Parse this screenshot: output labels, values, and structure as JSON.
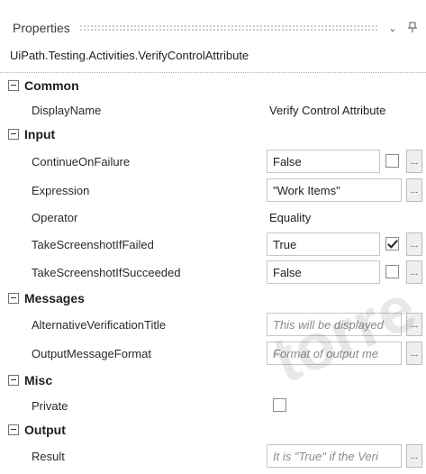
{
  "panel": {
    "title": "Properties",
    "dropdown_glyph": "⌄",
    "pin_glyph": "ꟷ",
    "type_name": "UiPath.Testing.Activities.VerifyControlAttribute"
  },
  "categories": {
    "common": "Common",
    "input": "Input",
    "messages": "Messages",
    "misc": "Misc",
    "output": "Output"
  },
  "props": {
    "display_name": {
      "label": "DisplayName",
      "value": "Verify Control Attribute"
    },
    "continue_on_failure": {
      "label": "ContinueOnFailure",
      "value": "False",
      "checked": false
    },
    "expression": {
      "label": "Expression",
      "value": "\"Work Items\""
    },
    "operator": {
      "label": "Operator",
      "value": "Equality"
    },
    "take_screenshot_if_failed": {
      "label": "TakeScreenshotIfFailed",
      "value": "True",
      "checked": true
    },
    "take_screenshot_if_succeeded": {
      "label": "TakeScreenshotIfSucceeded",
      "value": "False",
      "checked": false
    },
    "alternative_verification_title": {
      "label": "AlternativeVerificationTitle",
      "placeholder": "This will be displayed"
    },
    "output_message_format": {
      "label": "OutputMessageFormat",
      "placeholder": "Format of output me"
    },
    "private": {
      "label": "Private",
      "checked": false
    },
    "result": {
      "label": "Result",
      "placeholder": "It is \"True\" if the Veri"
    }
  },
  "ellipsis_label": "...",
  "watermark": "torre"
}
